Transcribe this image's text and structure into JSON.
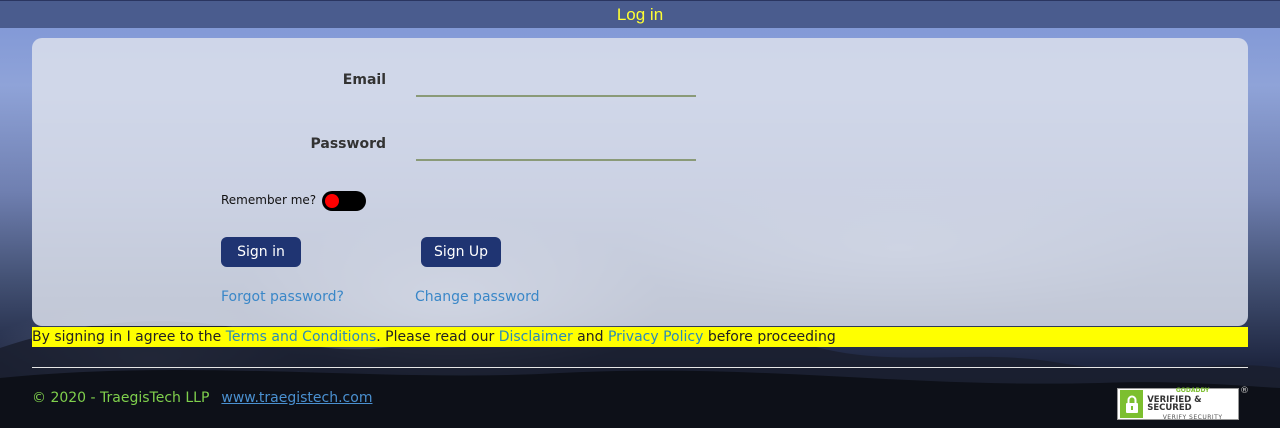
{
  "header": {
    "title": "Log in"
  },
  "form": {
    "email_label": "Email",
    "email_value": "",
    "password_label": "Password",
    "password_value": "",
    "remember_label": "Remember me?",
    "remember_checked": false,
    "signin_label": "Sign in",
    "signup_label": "Sign Up",
    "forgot_label": "Forgot password?",
    "change_label": "Change password"
  },
  "notice": {
    "part1": "By signing in I agree to the ",
    "terms": "Terms and Conditions",
    "part2": ". Please read our ",
    "disclaimer": "Disclaimer",
    "part3": " and ",
    "privacy": "Privacy Policy",
    "part4": " before proceeding"
  },
  "footer": {
    "copyright": "© 2020 - TraegisTech LLP",
    "website": "www.traegistech.com",
    "seal_brand": "GODADDY",
    "seal_main": "VERIFIED & SECURED",
    "seal_sub": "VERIFY SECURITY",
    "seal_reg": "®"
  },
  "colors": {
    "header_title": "#ffff33",
    "button_bg": "#1f3472",
    "link": "#3a87c8",
    "notice_bg": "#ffff00",
    "toggle_knob": "#ff0000",
    "copyright": "#7fd04c"
  }
}
